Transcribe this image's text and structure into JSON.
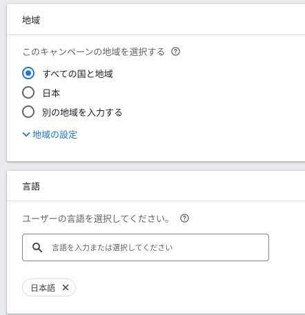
{
  "locations": {
    "title": "地域",
    "question": "このキャンペーンの地域を選択する",
    "options": [
      {
        "label": "すべての国と地域",
        "selected": true
      },
      {
        "label": "日本",
        "selected": false
      },
      {
        "label": "別の地域を入力する",
        "selected": false
      }
    ],
    "settings_link": "地域の設定"
  },
  "languages": {
    "title": "言語",
    "question": "ユーザーの言語を選択してください。",
    "search": {
      "placeholder": "言語を入力または選択してください",
      "value": ""
    },
    "selected_chips": [
      {
        "label": "日本語"
      }
    ]
  },
  "colors": {
    "accent": "#1a73e8",
    "text_primary": "#202124",
    "text_secondary": "#5f6368",
    "divider": "#dadce0"
  }
}
